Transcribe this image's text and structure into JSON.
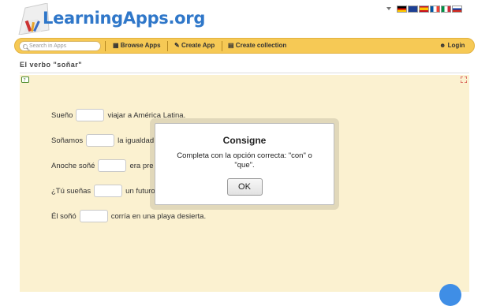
{
  "header": {
    "logo_text": "LearningApps.org",
    "languages": [
      "german-flag",
      "english-flag",
      "spanish-flag",
      "french-flag",
      "italian-flag",
      "russian-flag"
    ]
  },
  "nav": {
    "search_placeholder": "Search in Apps",
    "browse_label": "Browse Apps",
    "create_label": "Create App",
    "collection_label": "Create collection",
    "login_label": "Login"
  },
  "page": {
    "title": "El verbo \"soñar\""
  },
  "exercise": {
    "sentences": [
      {
        "before": "Sueño",
        "after": "viajar a América Latina."
      },
      {
        "before": "Soñamos",
        "after": "la igualdad"
      },
      {
        "before": "Anoche soñé",
        "after": "era pre"
      },
      {
        "before": "¿Tú sueñas",
        "after": "un futuro"
      },
      {
        "before": "Él soñó",
        "after": "corría en una playa desierta."
      }
    ]
  },
  "modal": {
    "title": "Consigne",
    "text": "Completa con la opción correcta: \"con\" o \"que\".",
    "ok_label": "OK"
  },
  "colors": {
    "brand_blue": "#2f77c9",
    "navbar": "#f6c955",
    "app_background": "#fbf1d0"
  }
}
